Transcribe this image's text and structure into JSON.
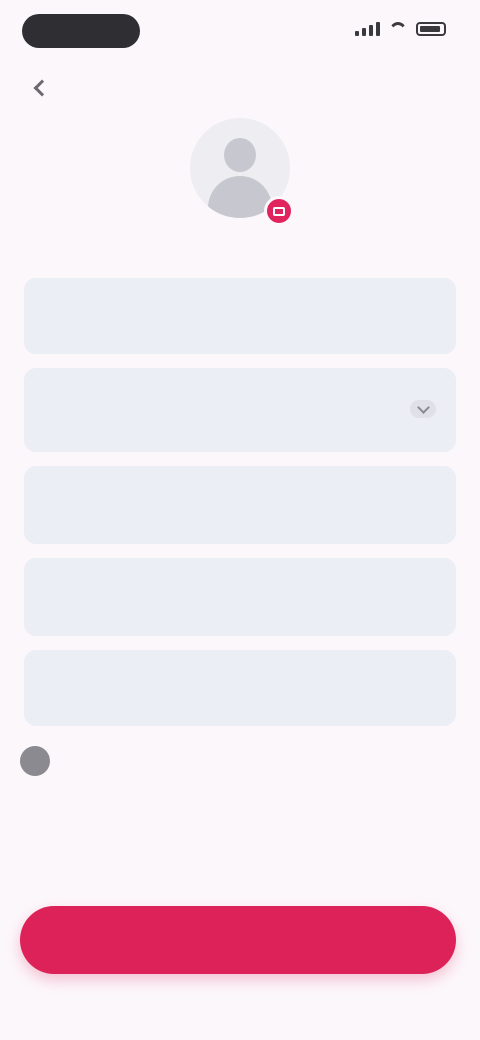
{
  "status_bar": {
    "time": "",
    "icons": [
      "signal-icon",
      "wifi-icon",
      "battery-icon"
    ]
  },
  "header": {
    "title": "",
    "back_icon": "chevron-left-icon"
  },
  "avatar": {
    "icon": "user-avatar-icon",
    "badge_icon": "camera-icon",
    "badge_color": "#e0245e"
  },
  "form": {
    "fields": [
      {
        "label": "",
        "value": "",
        "placeholder": ""
      },
      {
        "label": "",
        "value": "",
        "placeholder": ""
      },
      {
        "label": "",
        "value": "",
        "placeholder": ""
      },
      {
        "label": "",
        "value": "",
        "placeholder": ""
      },
      {
        "label": "",
        "value": "",
        "placeholder": ""
      }
    ]
  },
  "consent": {
    "text": "",
    "terms": "",
    "terms_link": ""
  },
  "primary_button": {
    "label": "",
    "color": "#dc2258"
  }
}
